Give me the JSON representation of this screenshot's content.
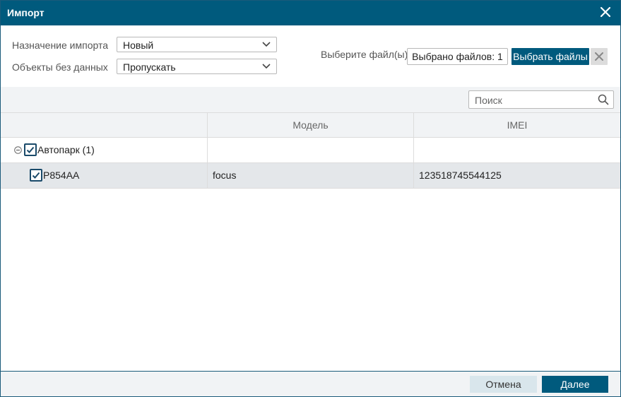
{
  "dialog": {
    "title": "Импорт",
    "close_icon": "close-icon"
  },
  "settings": {
    "destination_label": "Назначение импорта",
    "destination_value": "Новый",
    "empty_objects_label": "Объекты без данных",
    "empty_objects_value": "Пропускать",
    "file_label": "Выберите файл(ы)",
    "file_count": "Выбрано файлов: 1",
    "choose_files_label": "Выбрать файлы"
  },
  "search": {
    "placeholder": "Поиск",
    "icon": "search-icon"
  },
  "table": {
    "columns": [
      "",
      "Модель",
      "IMEI"
    ],
    "group": {
      "label": "Автопарк (1)",
      "checked": true,
      "expanded": true
    },
    "rows": [
      {
        "name": "Р854АА",
        "model": "focus",
        "imei": "123518745544125",
        "checked": true
      }
    ]
  },
  "footer": {
    "cancel_label": "Отмена",
    "next_label": "Далее"
  },
  "colors": {
    "primary": "#005a7d",
    "secondary_button": "#d9e6ec",
    "header_bg": "#f1f3f5",
    "selected_row": "#e4e7ea"
  }
}
